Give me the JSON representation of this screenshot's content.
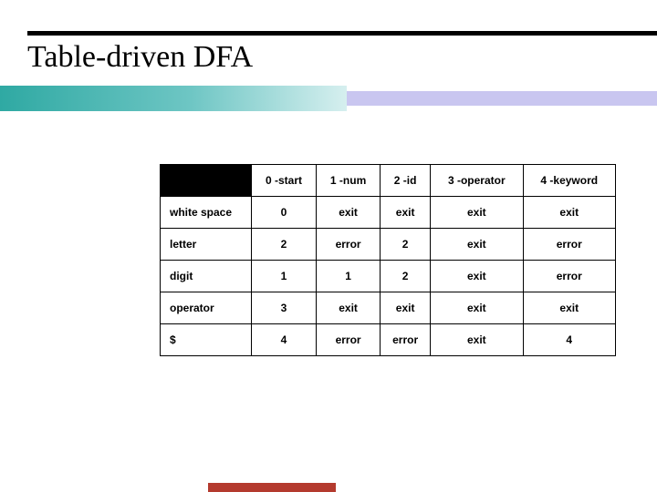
{
  "title": "Table-driven DFA",
  "chart_data": {
    "type": "table",
    "columns": [
      "0 -start",
      "1 -num",
      "2 -id",
      "3 -operator",
      "4 -keyword"
    ],
    "rows": [
      {
        "label": "white space",
        "cells": [
          "0",
          "exit",
          "exit",
          "exit",
          "exit"
        ]
      },
      {
        "label": "letter",
        "cells": [
          "2",
          "error",
          "2",
          "exit",
          "error"
        ]
      },
      {
        "label": "digit",
        "cells": [
          "1",
          "1",
          "2",
          "exit",
          "error"
        ]
      },
      {
        "label": "operator",
        "cells": [
          "3",
          "exit",
          "exit",
          "exit",
          "exit"
        ]
      },
      {
        "label": "$",
        "cells": [
          "4",
          "error",
          "error",
          "exit",
          "4"
        ]
      }
    ]
  }
}
